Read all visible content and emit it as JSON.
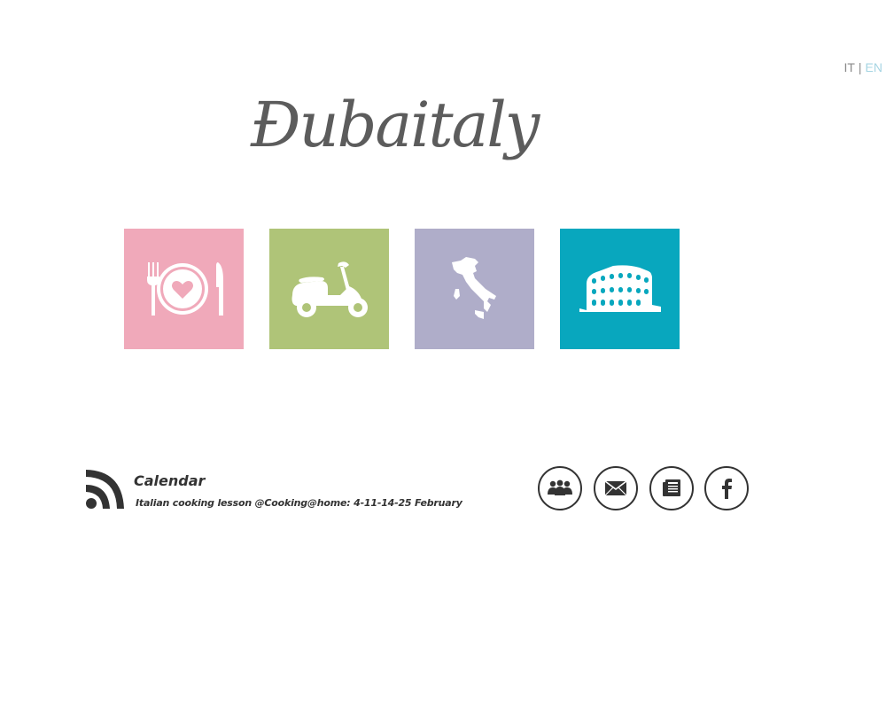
{
  "language": {
    "options": [
      "IT",
      "EN"
    ],
    "separator": "|",
    "active": "EN"
  },
  "logo": {
    "text": "Đubaitaly"
  },
  "tiles": [
    {
      "name": "food",
      "icon": "plate-fork-knife-icon",
      "color": "#f0a9ba"
    },
    {
      "name": "scooter",
      "icon": "scooter-icon",
      "color": "#afc478"
    },
    {
      "name": "italy",
      "icon": "italy-map-icon",
      "color": "#afadc9"
    },
    {
      "name": "colosseum",
      "icon": "colosseum-icon",
      "color": "#08a7be"
    }
  ],
  "news": {
    "icon": "rss-icon",
    "title": "Calendar",
    "text": "Italian cooking lesson @Cooking@home: 4-11-14-25 February"
  },
  "social": [
    {
      "name": "community",
      "icon": "people-icon"
    },
    {
      "name": "email",
      "icon": "envelope-icon"
    },
    {
      "name": "newsletter",
      "icon": "newspaper-icon"
    },
    {
      "name": "facebook",
      "icon": "facebook-icon"
    }
  ],
  "colors": {
    "text": "#333333",
    "logo": "#5c5c5c",
    "lang_active": "#a6d5e3",
    "lang_inactive": "#8a8a8a"
  }
}
